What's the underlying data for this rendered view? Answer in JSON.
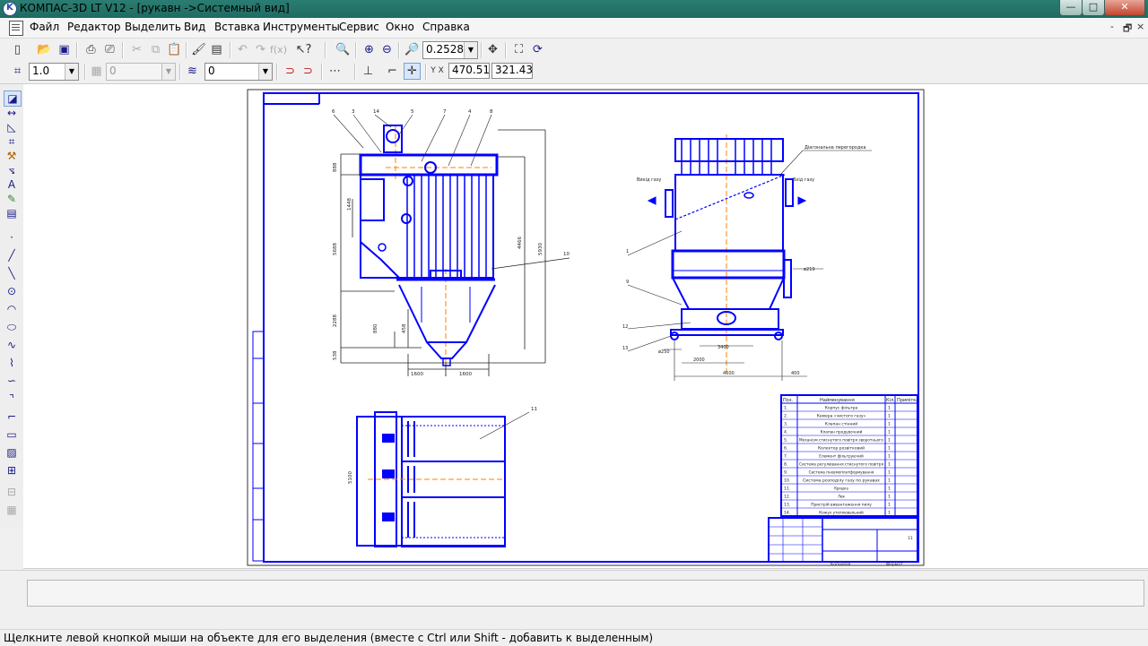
{
  "window": {
    "title": "КОМПАС-3D LT V12 - [рукавн ->Системный вид]",
    "minimize": "—",
    "maximize": "□",
    "close": "✕"
  },
  "menu": {
    "items": [
      "Файл",
      "Редактор",
      "Выделить",
      "Вид",
      "Вставка",
      "Инструменты",
      "Сервис",
      "Окно",
      "Справка"
    ],
    "mdi_minimize": "-",
    "mdi_restore": "🗗",
    "mdi_close": "×"
  },
  "toolbar1": {
    "zoom_value": "0.2528"
  },
  "toolbar2": {
    "line_scale": "1.0",
    "layer_state": "0",
    "layer_number": "0",
    "coord_x": "470.519",
    "coord_y": "321.43",
    "coord_label": "Y X"
  },
  "drawing": {
    "callouts_top": [
      "6",
      "3",
      "14",
      "5",
      "7",
      "4",
      "8"
    ],
    "dim_vertical_left": [
      "888",
      "1448",
      "5688",
      "2288",
      "538",
      "880",
      "458"
    ],
    "dim_bottom_left": [
      "1600",
      "1600"
    ],
    "dim_right": [
      "4466",
      "5930"
    ],
    "label_10": "10",
    "side_labels": {
      "diag": "Діагональна перегородка",
      "exit_gas": "Вихід газу",
      "inlet_gas": "Вхід газу",
      "item1": "1",
      "item9": "9",
      "item12": "12",
      "item13": "13",
      "d219": "ø219",
      "d250": "ø250",
      "dim_3400": "3400",
      "dim_2000": "2000",
      "dim_4500": "4500",
      "dim_400": "400"
    },
    "plan_label": "11",
    "plan_dim": "5100",
    "bom_header": [
      "Поз.",
      "Найменування",
      "Кіл.",
      "Примітка"
    ],
    "bom_rows": [
      [
        "1.",
        "Корпус фільтра",
        "1"
      ],
      [
        "2.",
        "Камера «чистого газу»",
        "1"
      ],
      [
        "3.",
        "Клапан стінний",
        "1"
      ],
      [
        "4.",
        "Клапан продувочний",
        "1"
      ],
      [
        "5.",
        "Механізм стиснутого повітря зворотнього",
        "1"
      ],
      [
        "6.",
        "Колектор розвітковий",
        "1"
      ],
      [
        "7.",
        "Елемент фільтруючий",
        "1"
      ],
      [
        "8.",
        "Система регулювання стиснутого повітря",
        "1"
      ],
      [
        "9.",
        "Система пневмоплатформування",
        "1"
      ],
      [
        "10.",
        "Система розподілу газу по рукавах",
        "1"
      ],
      [
        "11.",
        "Кришка",
        "1"
      ],
      [
        "12.",
        "Люк",
        "1"
      ],
      [
        "13.",
        "Пристрій вивантаження пилу",
        "1"
      ],
      [
        "14.",
        "Кожух утеплювальний",
        "1"
      ]
    ],
    "stamp_sheet": "11",
    "stamp_bottom_left": "Копіював",
    "stamp_bottom_right": "Формат"
  },
  "status": {
    "hint": "Щелкните левой кнопкой мыши на объекте для его выделения (вместе с Ctrl или Shift - добавить к выделенным)"
  },
  "colors": {
    "drawing_blue": "#0000ff",
    "axis_orange": "#ff8000",
    "titlebar": "#22736a"
  }
}
